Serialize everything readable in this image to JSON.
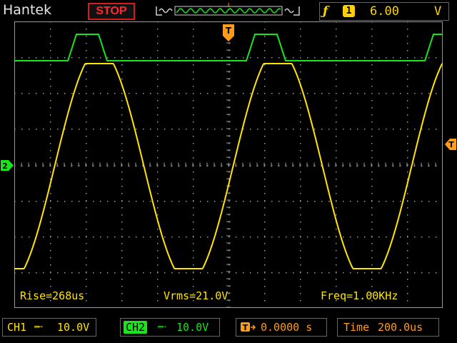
{
  "brand": "Hantek",
  "run_state": "STOP",
  "trigger": {
    "marker_label": "T",
    "source_number": "1",
    "level_value": "6.00",
    "level_unit": "V",
    "position_value": "0.0000 s"
  },
  "measurements": {
    "rise": "Rise=268us",
    "vrms": "Vrms=21.0V",
    "freq": "Freq=1.00KHz"
  },
  "channels": {
    "ch1": {
      "label": "CH1",
      "volts_per_div": "10.0V",
      "color": "#ffe600"
    },
    "ch2": {
      "label": "CH2",
      "volts_per_div": "10.0V",
      "color": "#19e619"
    }
  },
  "timebase": {
    "label": "Time",
    "value": "200.0us"
  },
  "colors": {
    "trigger": "#ff9c1a",
    "stop": "#ff2a2a",
    "grid": "#9a9a9a",
    "trigger_info": "#ffd100"
  },
  "icons": {
    "trigger_edge": "rising-edge-f-icon",
    "trigger_position": "trigger-position-icon",
    "coupling": "dc-coupling-icon"
  }
}
